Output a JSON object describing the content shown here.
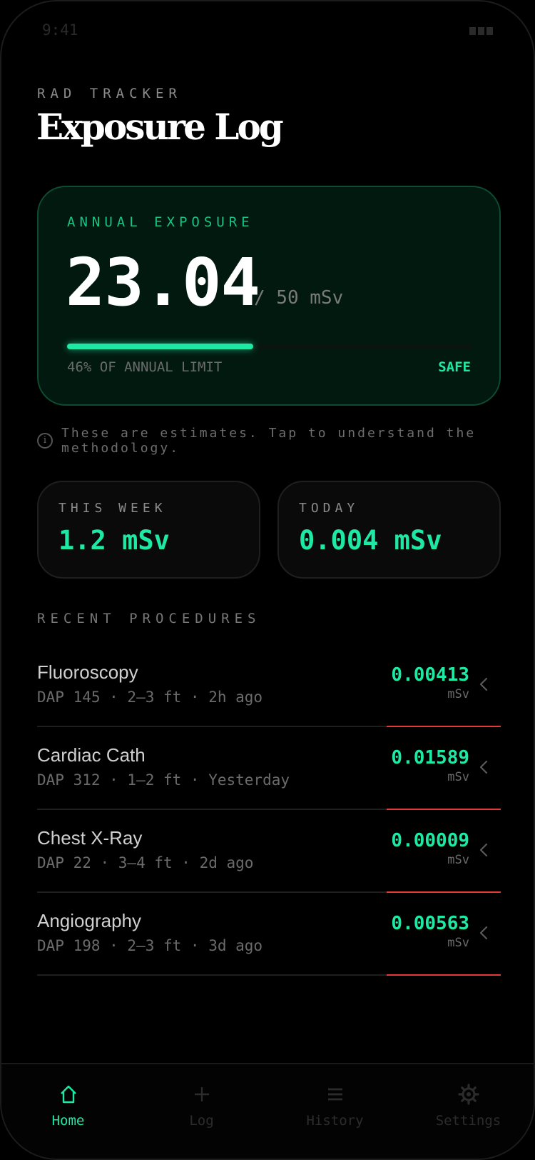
{
  "status_bar": {
    "time": "9:41"
  },
  "header": {
    "app_label": "RAD TRACKER",
    "title": "Exposure Log"
  },
  "annual": {
    "label": "ANNUAL EXPOSURE",
    "value": "23.04",
    "limit": "/ 50 mSv",
    "progress_fraction": 0.46,
    "progress_text": "46% OF ANNUAL LIMIT",
    "status": "SAFE"
  },
  "info_note": {
    "icon": "info-icon",
    "text": "These are estimates. Tap to understand the methodology."
  },
  "stats": {
    "week": {
      "label": "THIS WEEK",
      "value": "1.2 mSv"
    },
    "today": {
      "label": "TODAY",
      "value": "0.004 mSv"
    }
  },
  "recent": {
    "title": "RECENT PROCEDURES",
    "items": [
      {
        "name": "Fluoroscopy",
        "meta": "DAP 145 · 2–3 ft · 2h ago",
        "dose": "0.00413",
        "unit": "mSv"
      },
      {
        "name": "Cardiac Cath",
        "meta": "DAP 312 · 1–2 ft · Yesterday",
        "dose": "0.01589",
        "unit": "mSv"
      },
      {
        "name": "Chest X-Ray",
        "meta": "DAP 22 · 3–4 ft · 2d ago",
        "dose": "0.00009",
        "unit": "mSv"
      },
      {
        "name": "Angiography",
        "meta": "DAP 198 · 2–3 ft · 3d ago",
        "dose": "0.00563",
        "unit": "mSv"
      }
    ]
  },
  "tabs": [
    {
      "label": "Home",
      "icon": "home-icon",
      "active": true
    },
    {
      "label": "Log",
      "icon": "plus-icon",
      "active": false
    },
    {
      "label": "History",
      "icon": "list-icon",
      "active": false
    },
    {
      "label": "Settings",
      "icon": "gear-icon",
      "active": false
    }
  ],
  "colors": {
    "accent": "#1de9a4",
    "card_bg": "#021910",
    "card_border": "#0d4c31",
    "alert_line": "#e53935",
    "muted": "#6b6b6b"
  }
}
